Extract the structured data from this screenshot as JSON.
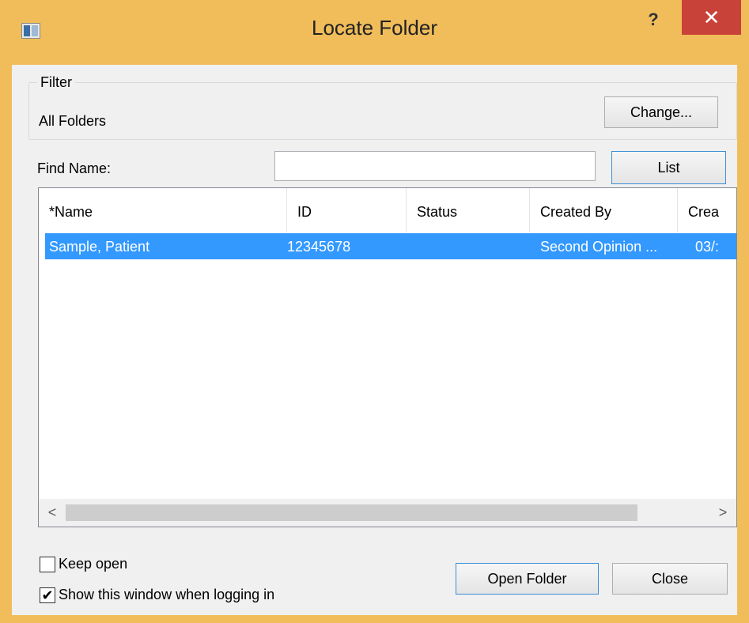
{
  "window": {
    "title": "Locate Folder",
    "help_glyph": "?",
    "close_glyph": "✕",
    "colors": {
      "frame": "#f0bd5a",
      "close_button": "#c9423a",
      "selection": "#3399ff"
    }
  },
  "filter": {
    "group_label": "Filter",
    "value": "All Folders",
    "change_label": "Change..."
  },
  "find": {
    "label": "Find Name:",
    "value": "",
    "list_label": "List"
  },
  "list": {
    "columns": [
      "*Name",
      "ID",
      "Status",
      "Created By",
      "Crea"
    ],
    "rows": [
      {
        "name": "Sample, Patient",
        "id": "12345678",
        "status": "",
        "created_by": "Second Opinion ...",
        "created": "03/:"
      }
    ],
    "scroll_left": "<",
    "scroll_right": ">"
  },
  "options": {
    "keep_open": {
      "label": "Keep open",
      "checked": false
    },
    "show_on_login": {
      "label": "Show this window when logging in",
      "checked": true,
      "mark": "✔"
    }
  },
  "actions": {
    "open_label": "Open Folder",
    "close_label": "Close"
  }
}
